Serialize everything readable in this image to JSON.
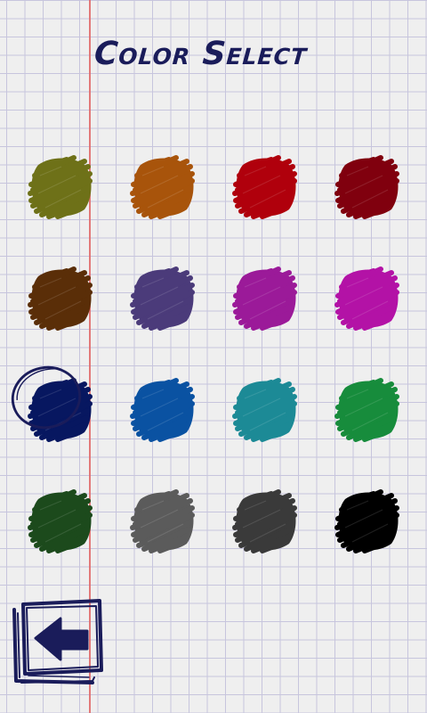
{
  "screen": {
    "title": "Color Select",
    "selected_color_index": 8
  },
  "palette": [
    {
      "name": "olive",
      "color": "#6e7118"
    },
    {
      "name": "orange-brown",
      "color": "#a8540b"
    },
    {
      "name": "red",
      "color": "#b0000c"
    },
    {
      "name": "dark-red",
      "color": "#80000e"
    },
    {
      "name": "brown",
      "color": "#5a2e08"
    },
    {
      "name": "slate-purple",
      "color": "#4b3b7a"
    },
    {
      "name": "purple",
      "color": "#9b1a99"
    },
    {
      "name": "magenta",
      "color": "#b312a6"
    },
    {
      "name": "navy",
      "color": "#071760"
    },
    {
      "name": "blue",
      "color": "#0a52a2"
    },
    {
      "name": "teal",
      "color": "#1c8a96"
    },
    {
      "name": "green",
      "color": "#178c3c"
    },
    {
      "name": "dark-green",
      "color": "#1c4a1c"
    },
    {
      "name": "gray",
      "color": "#5b5b5b"
    },
    {
      "name": "dark-gray",
      "color": "#3a3a3a"
    },
    {
      "name": "black",
      "color": "#000000"
    }
  ],
  "ink_color": "#1a1c5a",
  "back_button": {
    "icon": "back-arrow-icon"
  }
}
